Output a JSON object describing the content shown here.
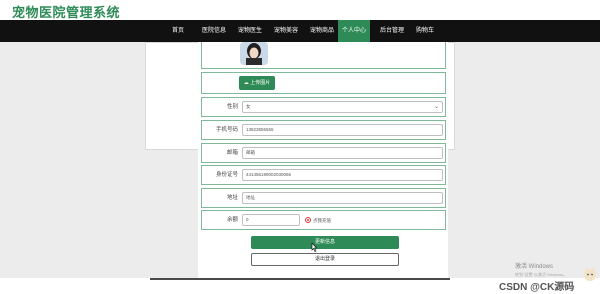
{
  "app": {
    "title": "宠物医院管理系统"
  },
  "nav": {
    "items": [
      {
        "label": "首页",
        "active": false
      },
      {
        "label": "医院信息",
        "active": false
      },
      {
        "label": "宠物医生",
        "active": false
      },
      {
        "label": "宠物美容",
        "active": false
      },
      {
        "label": "宠物商品",
        "active": false
      },
      {
        "label": "个人中心",
        "active": true
      },
      {
        "label": "后台管理",
        "active": false
      },
      {
        "label": "购物车",
        "active": false
      }
    ]
  },
  "profile": {
    "upload_button": "上传图片",
    "fields": {
      "gender": {
        "label": "性别",
        "value": "女"
      },
      "phone": {
        "label": "手机号码",
        "value": "13823855555"
      },
      "email": {
        "label": "邮箱",
        "value": "邮箱"
      },
      "id_card": {
        "label": "身份证号",
        "value": "441456199002030066"
      },
      "address": {
        "label": "地址",
        "value": "地址"
      },
      "balance": {
        "label": "余额",
        "value": "0",
        "recharge_label": "点我充值"
      }
    },
    "update_button": "更新信息",
    "logout_button": "退出登录"
  },
  "overlay": {
    "windows_activation": "激活 Windows",
    "windows_activation_hint": "转到\"设置\"以激活 Windows。",
    "csdn_watermark": "CSDN @CK源码"
  },
  "colors": {
    "accent": "#2e8b57",
    "navbar": "#111111"
  }
}
